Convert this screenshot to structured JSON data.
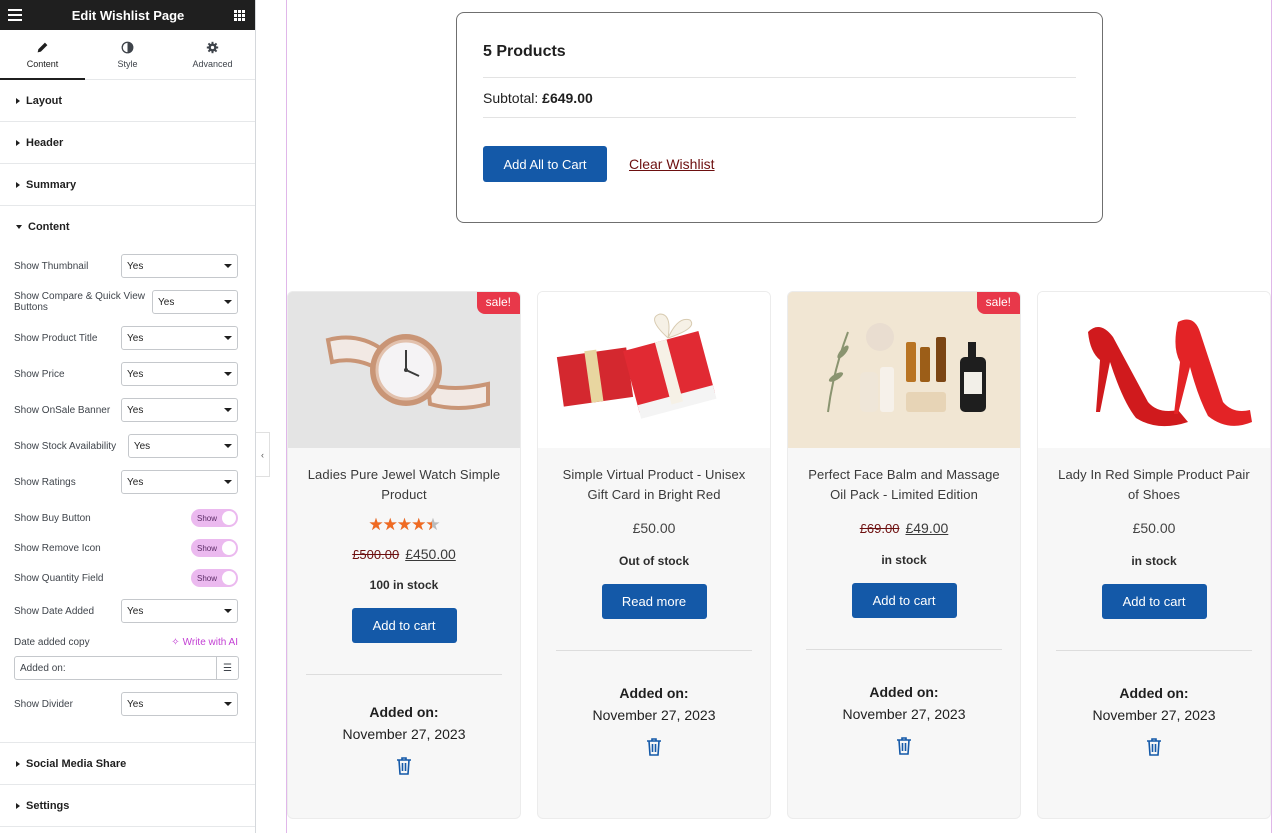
{
  "panel": {
    "title": "Edit Wishlist Page",
    "tabs": [
      {
        "label": "Content",
        "icon": "pencil-icon"
      },
      {
        "label": "Style",
        "icon": "contrast-icon"
      },
      {
        "label": "Advanced",
        "icon": "gear-icon"
      }
    ],
    "sections": {
      "layout": "Layout",
      "header": "Header",
      "summary": "Summary",
      "content": "Content",
      "social": "Social Media Share",
      "settings": "Settings"
    },
    "controls": {
      "show_thumbnail": {
        "label": "Show Thumbnail",
        "value": "Yes"
      },
      "show_compare": {
        "label": "Show Compare & Quick View Buttons",
        "value": "Yes"
      },
      "show_title": {
        "label": "Show Product Title",
        "value": "Yes"
      },
      "show_price": {
        "label": "Show Price",
        "value": "Yes"
      },
      "show_onsale": {
        "label": "Show OnSale Banner",
        "value": "Yes"
      },
      "show_stock": {
        "label": "Show Stock Availability",
        "value": "Yes"
      },
      "show_ratings": {
        "label": "Show Ratings",
        "value": "Yes"
      },
      "show_buy": {
        "label": "Show Buy Button",
        "value": "Show"
      },
      "show_remove": {
        "label": "Show Remove Icon",
        "value": "Show"
      },
      "show_qty": {
        "label": "Show Quantity Field",
        "value": "Show"
      },
      "show_date": {
        "label": "Show Date Added",
        "value": "Yes"
      },
      "date_copy": {
        "label": "Date added copy",
        "ai": "Write with AI",
        "value": "Added on:"
      },
      "show_divider": {
        "label": "Show Divider",
        "value": "Yes"
      }
    }
  },
  "summary": {
    "title": "5 Products",
    "subtotal_label": "Subtotal:",
    "subtotal_value": "£649.00",
    "add_all": "Add All to Cart",
    "clear": "Clear Wishlist"
  },
  "products": [
    {
      "title": "Ladies Pure Jewel Watch Simple Product",
      "sale": "sale!",
      "rating": 4.5,
      "old_price": "£500.00",
      "price": "£450.00",
      "stock": "100 in stock",
      "button": "Add to cart",
      "added_label": "Added on:",
      "added_date": "November 27, 2023"
    },
    {
      "title": "Simple Virtual Product - Unisex Gift Card in Bright Red",
      "price": "£50.00",
      "stock": "Out of stock",
      "button": "Read more",
      "added_label": "Added on:",
      "added_date": "November 27, 2023"
    },
    {
      "title": "Perfect Face Balm and Massage Oil Pack - Limited Edition",
      "sale": "sale!",
      "old_price": "£69.00",
      "price": "£49.00",
      "stock": "in stock",
      "button": "Add to cart",
      "added_label": "Added on:",
      "added_date": "November 27, 2023"
    },
    {
      "title": "Lady In Red Simple Product Pair of Shoes",
      "price": "£50.00",
      "stock": "in stock",
      "button": "Add to cart",
      "added_label": "Added on:",
      "added_date": "November 27, 2023"
    }
  ],
  "colors": {
    "accent": "#1459a8",
    "sale": "#e8384a",
    "toggle": "#ebb9ef",
    "link": "#6d0f0f"
  }
}
